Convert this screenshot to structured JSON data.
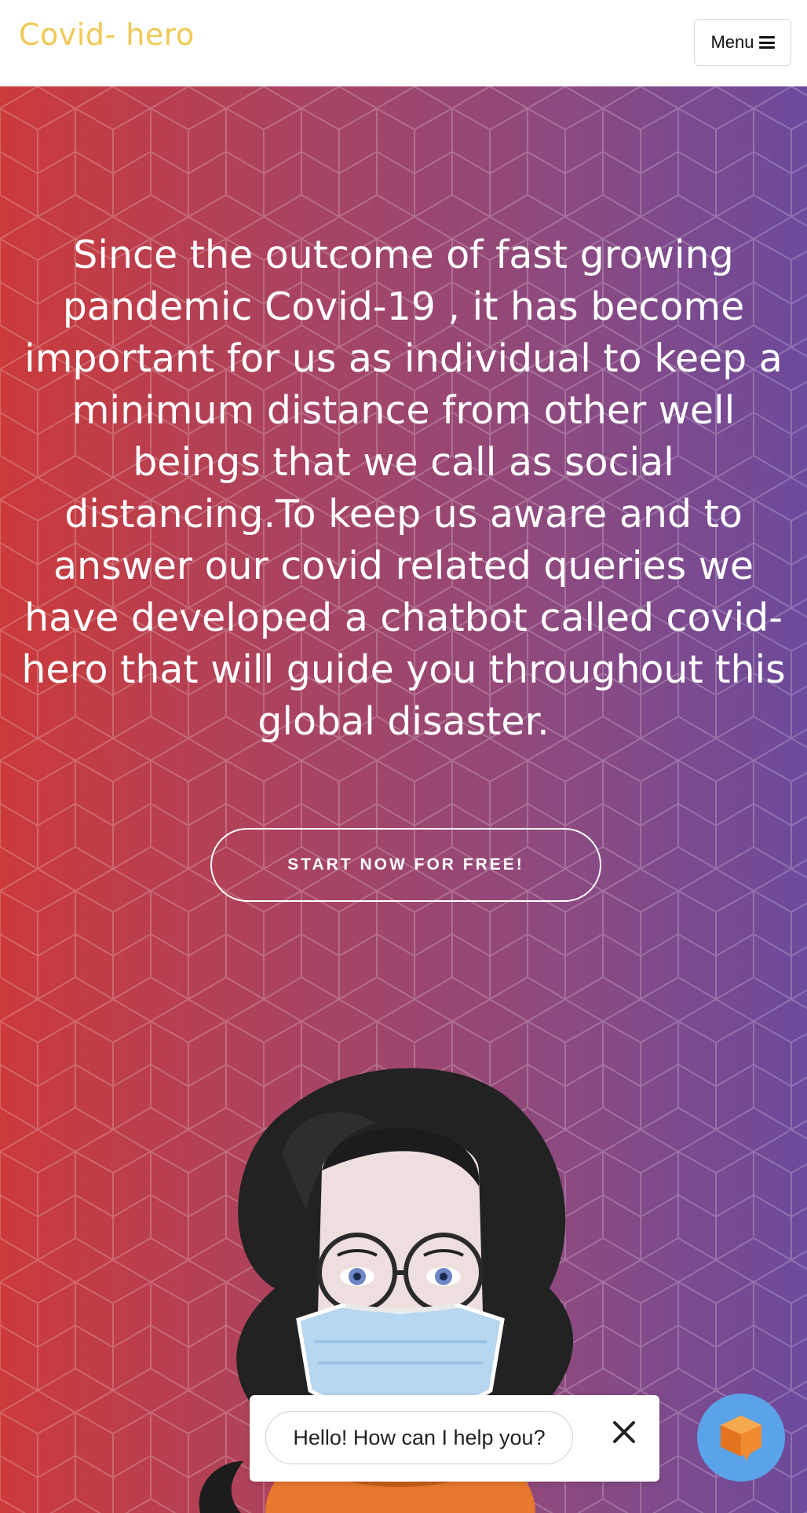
{
  "nav": {
    "brand": "Covid- hero",
    "menu_label": "Menu",
    "menu_icon": "hamburger-icon"
  },
  "hero": {
    "text": "Since the outcome of fast growing pandemic Covid-19 , it has become important for us as individual to keep a minimum distance from other well beings that we call as social distancing.To keep us aware and to answer our covid related queries we have developed a chatbot called covid-hero that will guide you throughout this global disaster.",
    "cta_label": "START NOW FOR FREE!"
  },
  "chat": {
    "greeting": "Hello! How can I help you?",
    "close_icon": "close-icon",
    "launcher_icon": "chat-cube-icon"
  },
  "colors": {
    "brand": "#f0c955",
    "gradient_start": "#cc3a3a",
    "gradient_end": "#6c4a9c",
    "launcher": "#5aa3e8",
    "launcher_icon": "#f08a30"
  }
}
